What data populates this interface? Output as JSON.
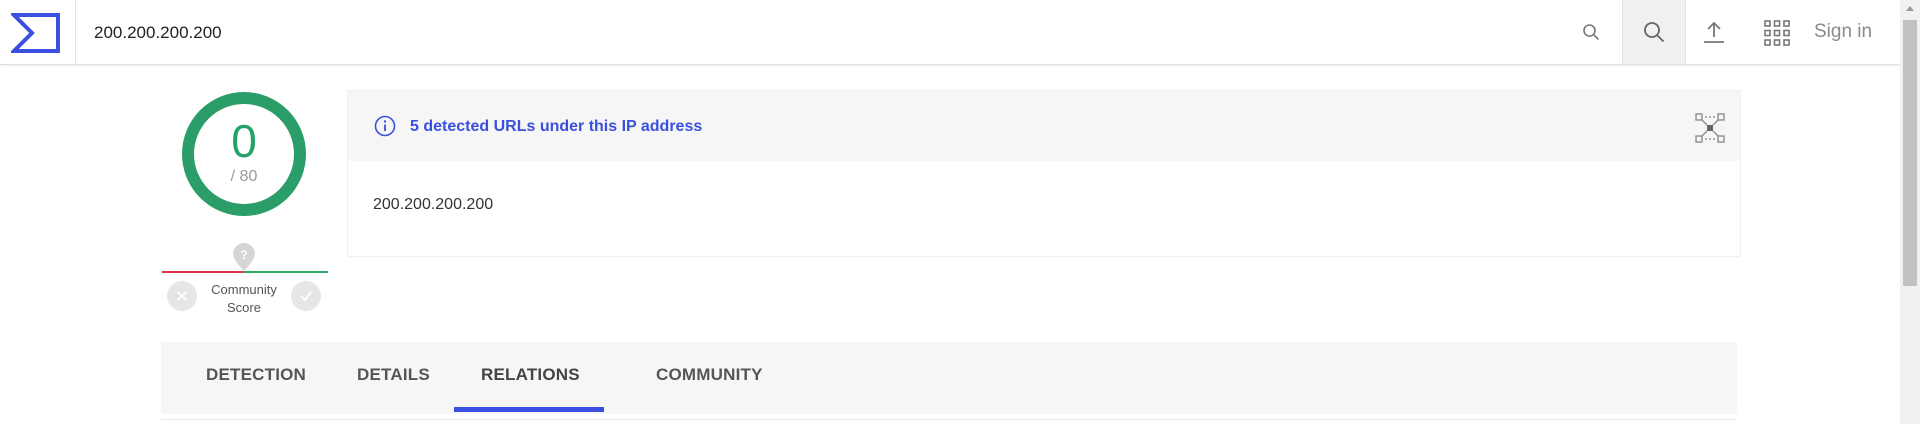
{
  "header": {
    "search_value": "200.200.200.200",
    "signin_label": "Sign in",
    "icons": [
      "logo-icon",
      "search-icon",
      "search-icon",
      "upload-icon",
      "apps-grid-icon"
    ]
  },
  "score": {
    "detections": "0",
    "total": "/ 80",
    "community_marker": "?",
    "community_label_line1": "Community",
    "community_label_line2": "Score"
  },
  "card": {
    "title": "5 detected URLs under this IP address",
    "ip": "200.200.200.200"
  },
  "tabs": [
    {
      "label": "DETECTION",
      "active": false
    },
    {
      "label": "DETAILS",
      "active": false
    },
    {
      "label": "RELATIONS",
      "active": true
    },
    {
      "label": "COMMUNITY",
      "active": false
    }
  ],
  "colors": {
    "accent": "#3b4fe0",
    "clean_green": "#23a36a",
    "bad_red": "#e0384b",
    "panel_bg": "#f6f6f6"
  }
}
